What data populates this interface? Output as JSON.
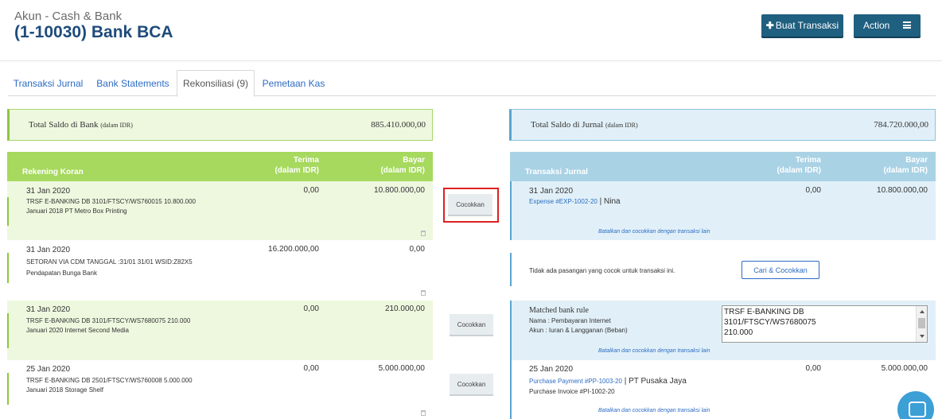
{
  "header": {
    "subtitle": "Akun - Cash & Bank",
    "title": "(1-10030) Bank BCA",
    "buat_transaksi": "Buat Transaksi",
    "action": "Action"
  },
  "tabs": [
    {
      "label": "Transaksi Jurnal"
    },
    {
      "label": "Bank Statements"
    },
    {
      "label": "Rekonsiliasi (9)"
    },
    {
      "label": "Pemetaan Kas"
    }
  ],
  "totals": {
    "bank_label": "Total Saldo di Bank",
    "bank_unit": "(dalam IDR)",
    "bank_value": "885.410.000,00",
    "jurnal_label": "Total Saldo di Jurnal",
    "jurnal_unit": "(dalam IDR)",
    "jurnal_value": "784.720.000,00"
  },
  "left_table": {
    "title": "Rekening Koran",
    "col_terima": "Terima",
    "col_bayar": "Bayar",
    "col_unit": "(dalam IDR)",
    "rows": [
      {
        "date": "31 Jan 2020",
        "desc1": "TRSF E-BANKING DB 3101/FTSCY/WS760015 10.800.000",
        "desc2": "Januari 2018 PT Metro Box Printing",
        "terima": "0,00",
        "bayar": "10.800.000,00"
      },
      {
        "date": "31 Jan 2020",
        "desc1": "SETORAN VIA CDM TANGGAL :31/01 31/01 WSID:Z82X5",
        "desc2": "Pendapatan Bunga Bank",
        "terima": "16.200.000,00",
        "bayar": "0,00"
      },
      {
        "date": "31 Jan 2020",
        "desc1": "TRSF E-BANKING DB 3101/FTSCY/WS7680075 210.000",
        "desc2": "Januari 2020 Internet Second Media",
        "terima": "0,00",
        "bayar": "210.000,00"
      },
      {
        "date": "25 Jan 2020",
        "desc1": "TRSF E-BANKING DB 2501/FTSCY/WS760008 5.000.000",
        "desc2": "Januari 2018 Storage Shelf",
        "terima": "0,00",
        "bayar": "5.000.000,00"
      }
    ]
  },
  "match_label": "Cocokkan",
  "right_table": {
    "title": "Transaksi Jurnal",
    "col_terima": "Terima",
    "col_bayar": "Bayar",
    "col_unit": "(dalam IDR)",
    "cancel_text": "Batalkan dan cocokkan dengan transaksi lain",
    "row1": {
      "date": "31 Jan 2020",
      "link": "Expense #EXP-1002-20",
      "sep": " | ",
      "contact": "Nina",
      "terima": "0,00",
      "bayar": "10.800.000,00"
    },
    "row2": {
      "text": "Tidak ada pasangan yang cocok untuk transaksi ini.",
      "button": "Cari & Cocokkan"
    },
    "row3": {
      "title": "Matched bank rule",
      "nama": "Nama : Pembayaran Internet",
      "akun": "Akun : Iuran & Langganan (Beban)",
      "box_line1": "TRSF E-BANKING DB",
      "box_line2": "3101/FTSCY/WS7680075",
      "box_line3": "210.000"
    },
    "row4": {
      "date": "25 Jan 2020",
      "link": "Purchase Payment #PP-1003-20",
      "sep": " | ",
      "contact": "PT Pusaka Jaya",
      "line2": "Purchase Invoice #PI-1002-20",
      "terima": "0,00",
      "bayar": "5.000.000,00"
    }
  }
}
